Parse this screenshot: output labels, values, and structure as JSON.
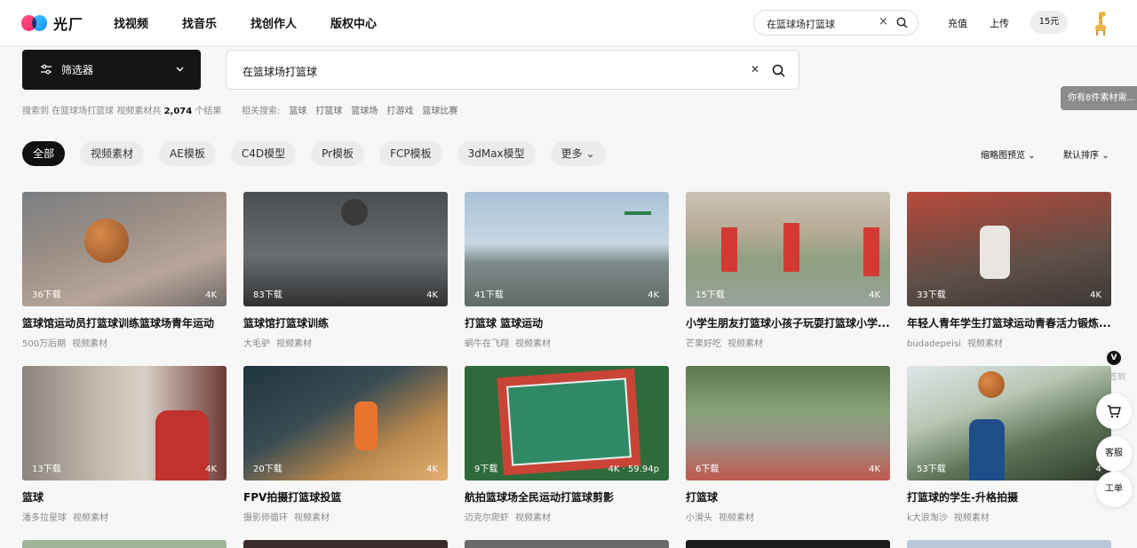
{
  "brand": {
    "name": "光厂"
  },
  "nav": [
    "找视频",
    "找音乐",
    "找创作人",
    "版权中心"
  ],
  "top_search": {
    "value": "在篮球场打篮球"
  },
  "top_actions": {
    "recharge": "充值",
    "upload": "上传",
    "coins": "15元"
  },
  "filter": {
    "label": "筛选器"
  },
  "search": {
    "value": "在篮球场打篮球"
  },
  "result": {
    "prefix": "搜索到",
    "query": "在篮球场打篮球",
    "middle": "视频素材共",
    "count": "2,074",
    "suffix": "个结果"
  },
  "related": {
    "label": "相关搜索:",
    "items": [
      "篮球",
      "打篮球",
      "篮球场",
      "打游戏",
      "篮球比赛"
    ]
  },
  "notice": "你有8件素材需...",
  "tabs": [
    "全部",
    "视频素材",
    "AE模板",
    "C4D模型",
    "Pr模板",
    "FCP模板",
    "3dMax模型",
    "更多"
  ],
  "sort": {
    "preview": "缩略图预览",
    "order": "默认排序"
  },
  "cards": [
    {
      "downloads": "36下载",
      "quality": "4K",
      "title": "篮球馆运动员打篮球训练篮球场青年运动",
      "author": "500万后期",
      "type": "视频素材"
    },
    {
      "downloads": "83下载",
      "quality": "4K",
      "title": "篮球馆打篮球训练",
      "author": "大毛驴",
      "type": "视频素材"
    },
    {
      "downloads": "41下载",
      "quality": "4K",
      "title": "打篮球 篮球运动",
      "author": "蜗牛在飞翔",
      "type": "视频素材"
    },
    {
      "downloads": "15下载",
      "quality": "4K",
      "title": "小学生朋友打篮球小孩子玩耍打篮球小学...",
      "author": "芒果好吃",
      "type": "视频素材"
    },
    {
      "downloads": "33下载",
      "quality": "4K",
      "title": "年轻人青年学生打篮球运动青春活力锻炼...",
      "author": "budadepeisi",
      "type": "视频素材"
    },
    {
      "downloads": "13下载",
      "quality": "4K",
      "title": "篮球",
      "author": "潘多拉星球",
      "type": "视频素材"
    },
    {
      "downloads": "20下载",
      "quality": "4K",
      "title": "FPV拍摄打篮球投篮",
      "author": "摄影师循环",
      "type": "视频素材"
    },
    {
      "downloads": "9下载",
      "quality": "4K · 59.94p",
      "title": "航拍篮球场全民运动打篮球剪影",
      "author": "迈克尔爬虾",
      "type": "视频素材"
    },
    {
      "downloads": "6下载",
      "quality": "4K",
      "title": "打篮球",
      "author": "小滑头",
      "type": "视频素材"
    },
    {
      "downloads": "53下载",
      "quality": "4",
      "title": "打篮球的学生-升格拍摄",
      "author": "k大浪淘沙",
      "type": "视频素材"
    }
  ],
  "side": {
    "vip": "V",
    "signin": "签到",
    "service": "客服",
    "ticket": "工单"
  },
  "colors": {
    "accent": "#111111",
    "brand_pink": "#ff2e63",
    "brand_blue": "#1f8bff"
  }
}
